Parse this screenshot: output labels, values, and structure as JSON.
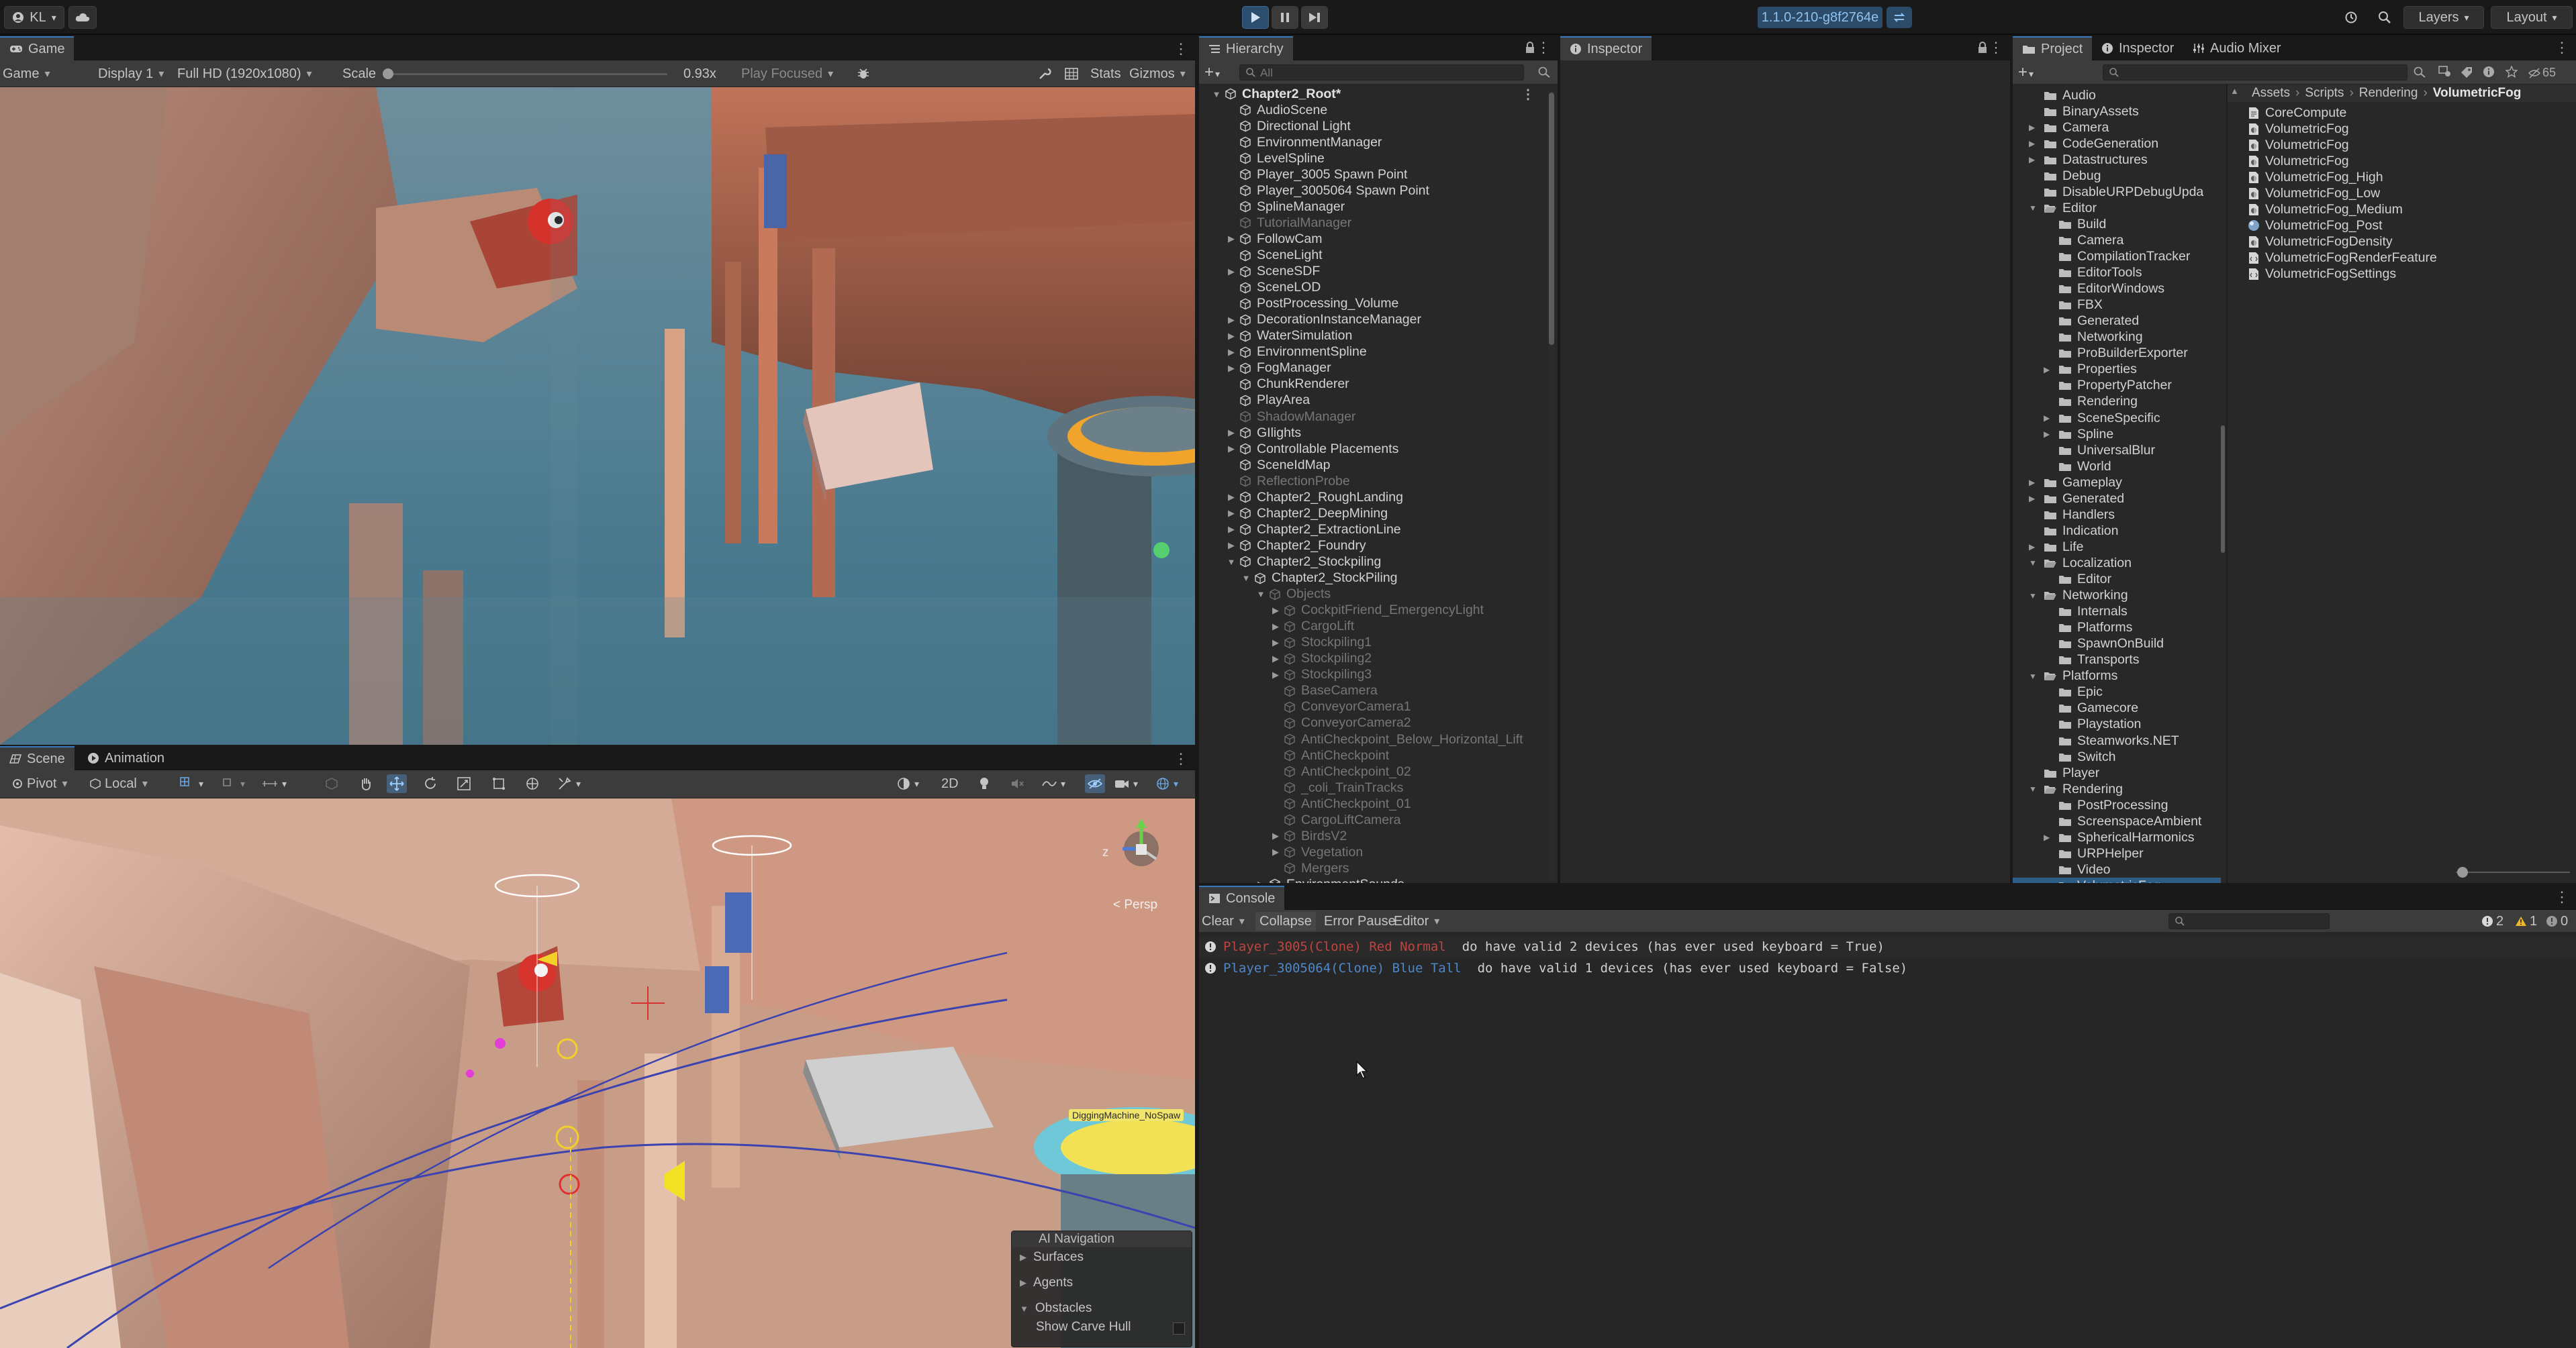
{
  "topbar": {
    "account": "KL",
    "version": "1.1.0-210-g8f2764e",
    "layers": "Layers",
    "layout": "Layout"
  },
  "game": {
    "tab": "Game",
    "mode": "Game",
    "display": "Display 1",
    "resolution": "Full HD (1920x1080)",
    "scale_label": "Scale",
    "scale_value": "0.93x",
    "scale_fraction": 0.0,
    "play_focused": "Play Focused",
    "stats": "Stats",
    "gizmos": "Gizmos"
  },
  "scene": {
    "tab": "Scene",
    "tab2": "Animation",
    "pivot": "Pivot",
    "local": "Local",
    "twod": "2D",
    "persp": "< Persp",
    "axis_z": "z",
    "label_tag": "DiggingMachine_NoSpaw",
    "overlay_title": "AI Navigation",
    "overlay_items": [
      "Surfaces",
      "Agents",
      "Obstacles"
    ],
    "overlay_toggle": "Show Carve Hull"
  },
  "hierarchy": {
    "tab": "Hierarchy",
    "search_placeholder": "All",
    "rows": [
      {
        "label": "Chapter2_Root*",
        "depth": 0,
        "arrow": "open",
        "style": "hdr"
      },
      {
        "label": "AudioScene",
        "depth": 1,
        "arrow": "",
        "style": ""
      },
      {
        "label": "Directional Light",
        "depth": 1,
        "arrow": "",
        "style": ""
      },
      {
        "label": "EnvironmentManager",
        "depth": 1,
        "arrow": "",
        "style": ""
      },
      {
        "label": "LevelSpline",
        "depth": 1,
        "arrow": "",
        "style": ""
      },
      {
        "label": "Player_3005 Spawn Point",
        "depth": 1,
        "arrow": "",
        "style": ""
      },
      {
        "label": "Player_3005064 Spawn Point",
        "depth": 1,
        "arrow": "",
        "style": ""
      },
      {
        "label": "SplineManager",
        "depth": 1,
        "arrow": "",
        "style": ""
      },
      {
        "label": "TutorialManager",
        "depth": 1,
        "arrow": "",
        "style": "dim"
      },
      {
        "label": "FollowCam",
        "depth": 1,
        "arrow": "closed",
        "style": ""
      },
      {
        "label": "SceneLight",
        "depth": 1,
        "arrow": "",
        "style": ""
      },
      {
        "label": "SceneSDF",
        "depth": 1,
        "arrow": "closed",
        "style": ""
      },
      {
        "label": "SceneLOD",
        "depth": 1,
        "arrow": "",
        "style": ""
      },
      {
        "label": "PostProcessing_Volume",
        "depth": 1,
        "arrow": "",
        "style": ""
      },
      {
        "label": "DecorationInstanceManager",
        "depth": 1,
        "arrow": "closed",
        "style": ""
      },
      {
        "label": "WaterSimulation",
        "depth": 1,
        "arrow": "closed",
        "style": ""
      },
      {
        "label": "EnvironmentSpline",
        "depth": 1,
        "arrow": "closed",
        "style": ""
      },
      {
        "label": "FogManager",
        "depth": 1,
        "arrow": "closed",
        "style": ""
      },
      {
        "label": "ChunkRenderer",
        "depth": 1,
        "arrow": "",
        "style": ""
      },
      {
        "label": "PlayArea",
        "depth": 1,
        "arrow": "",
        "style": ""
      },
      {
        "label": "ShadowManager",
        "depth": 1,
        "arrow": "",
        "style": "dim"
      },
      {
        "label": "GIlights",
        "depth": 1,
        "arrow": "closed",
        "style": ""
      },
      {
        "label": "Controllable Placements",
        "depth": 1,
        "arrow": "closed",
        "style": ""
      },
      {
        "label": "SceneIdMap",
        "depth": 1,
        "arrow": "",
        "style": ""
      },
      {
        "label": "ReflectionProbe",
        "depth": 1,
        "arrow": "",
        "style": "dim"
      },
      {
        "label": "Chapter2_RoughLanding",
        "depth": 1,
        "arrow": "closed",
        "style": ""
      },
      {
        "label": "Chapter2_DeepMining",
        "depth": 1,
        "arrow": "closed",
        "style": ""
      },
      {
        "label": "Chapter2_ExtractionLine",
        "depth": 1,
        "arrow": "closed",
        "style": ""
      },
      {
        "label": "Chapter2_Foundry",
        "depth": 1,
        "arrow": "closed",
        "style": ""
      },
      {
        "label": "Chapter2_Stockpiling",
        "depth": 1,
        "arrow": "open",
        "style": ""
      },
      {
        "label": "Chapter2_StockPiling",
        "depth": 2,
        "arrow": "open",
        "style": ""
      },
      {
        "label": "Objects",
        "depth": 3,
        "arrow": "open",
        "style": "dim"
      },
      {
        "label": "CockpitFriend_EmergencyLight",
        "depth": 4,
        "arrow": "closed",
        "style": "dim"
      },
      {
        "label": "CargoLift",
        "depth": 4,
        "arrow": "closed",
        "style": "dim"
      },
      {
        "label": "Stockpiling1",
        "depth": 4,
        "arrow": "closed",
        "style": "dim"
      },
      {
        "label": "Stockpiling2",
        "depth": 4,
        "arrow": "closed",
        "style": "dim"
      },
      {
        "label": "Stockpiling3",
        "depth": 4,
        "arrow": "closed",
        "style": "dim"
      },
      {
        "label": "BaseCamera",
        "depth": 4,
        "arrow": "",
        "style": "dim"
      },
      {
        "label": "ConveyorCamera1",
        "depth": 4,
        "arrow": "",
        "style": "dim"
      },
      {
        "label": "ConveyorCamera2",
        "depth": 4,
        "arrow": "",
        "style": "dim"
      },
      {
        "label": "AntiCheckpoint_Below_Horizontal_Lift",
        "depth": 4,
        "arrow": "",
        "style": "dim"
      },
      {
        "label": "AntiCheckpoint",
        "depth": 4,
        "arrow": "",
        "style": "dim"
      },
      {
        "label": "AntiCheckpoint_02",
        "depth": 4,
        "arrow": "",
        "style": "dim"
      },
      {
        "label": "_coli_TrainTracks",
        "depth": 4,
        "arrow": "",
        "style": "dim"
      },
      {
        "label": "AntiCheckpoint_01",
        "depth": 4,
        "arrow": "",
        "style": "dim"
      },
      {
        "label": "CargoLiftCamera",
        "depth": 4,
        "arrow": "",
        "style": "dim"
      },
      {
        "label": "BirdsV2",
        "depth": 4,
        "arrow": "closed",
        "style": "dim"
      },
      {
        "label": "Vegetation",
        "depth": 4,
        "arrow": "closed",
        "style": "dim"
      },
      {
        "label": "Mergers",
        "depth": 4,
        "arrow": "",
        "style": "dim"
      },
      {
        "label": "EnvironmentSounds",
        "depth": 3,
        "arrow": "closed",
        "style": ""
      }
    ]
  },
  "inspector": {
    "tab": "Inspector"
  },
  "project": {
    "tabs": [
      "Project",
      "Inspector",
      "Audio Mixer"
    ],
    "hidden_count": "65",
    "breadcrumb": [
      "Assets",
      "Scripts",
      "Rendering",
      "VolumetricFog"
    ],
    "tree": [
      {
        "label": "Audio",
        "depth": 0,
        "arrow": ""
      },
      {
        "label": "BinaryAssets",
        "depth": 0,
        "arrow": ""
      },
      {
        "label": "Camera",
        "depth": 0,
        "arrow": "closed"
      },
      {
        "label": "CodeGeneration",
        "depth": 0,
        "arrow": "closed"
      },
      {
        "label": "Datastructures",
        "depth": 0,
        "arrow": "closed"
      },
      {
        "label": "Debug",
        "depth": 0,
        "arrow": ""
      },
      {
        "label": "DisableURPDebugUpda",
        "depth": 0,
        "arrow": ""
      },
      {
        "label": "Editor",
        "depth": 0,
        "arrow": "open"
      },
      {
        "label": "Build",
        "depth": 1,
        "arrow": ""
      },
      {
        "label": "Camera",
        "depth": 1,
        "arrow": ""
      },
      {
        "label": "CompilationTracker",
        "depth": 1,
        "arrow": ""
      },
      {
        "label": "EditorTools",
        "depth": 1,
        "arrow": ""
      },
      {
        "label": "EditorWindows",
        "depth": 1,
        "arrow": ""
      },
      {
        "label": "FBX",
        "depth": 1,
        "arrow": ""
      },
      {
        "label": "Generated",
        "depth": 1,
        "arrow": ""
      },
      {
        "label": "Networking",
        "depth": 1,
        "arrow": ""
      },
      {
        "label": "ProBuilderExporter",
        "depth": 1,
        "arrow": ""
      },
      {
        "label": "Properties",
        "depth": 1,
        "arrow": "closed"
      },
      {
        "label": "PropertyPatcher",
        "depth": 1,
        "arrow": ""
      },
      {
        "label": "Rendering",
        "depth": 1,
        "arrow": ""
      },
      {
        "label": "SceneSpecific",
        "depth": 1,
        "arrow": "closed"
      },
      {
        "label": "Spline",
        "depth": 1,
        "arrow": "closed"
      },
      {
        "label": "UniversalBlur",
        "depth": 1,
        "arrow": ""
      },
      {
        "label": "World",
        "depth": 1,
        "arrow": ""
      },
      {
        "label": "Gameplay",
        "depth": 0,
        "arrow": "closed"
      },
      {
        "label": "Generated",
        "depth": 0,
        "arrow": "closed"
      },
      {
        "label": "Handlers",
        "depth": 0,
        "arrow": ""
      },
      {
        "label": "Indication",
        "depth": 0,
        "arrow": ""
      },
      {
        "label": "Life",
        "depth": 0,
        "arrow": "closed"
      },
      {
        "label": "Localization",
        "depth": 0,
        "arrow": "open"
      },
      {
        "label": "Editor",
        "depth": 1,
        "arrow": ""
      },
      {
        "label": "Networking",
        "depth": 0,
        "arrow": "open"
      },
      {
        "label": "Internals",
        "depth": 1,
        "arrow": ""
      },
      {
        "label": "Platforms",
        "depth": 1,
        "arrow": ""
      },
      {
        "label": "SpawnOnBuild",
        "depth": 1,
        "arrow": ""
      },
      {
        "label": "Transports",
        "depth": 1,
        "arrow": ""
      },
      {
        "label": "Platforms",
        "depth": 0,
        "arrow": "open"
      },
      {
        "label": "Epic",
        "depth": 1,
        "arrow": ""
      },
      {
        "label": "Gamecore",
        "depth": 1,
        "arrow": ""
      },
      {
        "label": "Playstation",
        "depth": 1,
        "arrow": ""
      },
      {
        "label": "Steamworks.NET",
        "depth": 1,
        "arrow": ""
      },
      {
        "label": "Switch",
        "depth": 1,
        "arrow": ""
      },
      {
        "label": "Player",
        "depth": 0,
        "arrow": ""
      },
      {
        "label": "Rendering",
        "depth": 0,
        "arrow": "open"
      },
      {
        "label": "PostProcessing",
        "depth": 1,
        "arrow": ""
      },
      {
        "label": "ScreenspaceAmbient",
        "depth": 1,
        "arrow": ""
      },
      {
        "label": "SphericalHarmonics",
        "depth": 1,
        "arrow": "closed"
      },
      {
        "label": "URPHelper",
        "depth": 1,
        "arrow": ""
      },
      {
        "label": "Video",
        "depth": 1,
        "arrow": ""
      },
      {
        "label": "VolumetricFog",
        "depth": 1,
        "arrow": "",
        "selected": true
      }
    ],
    "files": [
      {
        "label": "CoreCompute",
        "icon": "compute"
      },
      {
        "label": "VolumetricFog",
        "icon": "shader"
      },
      {
        "label": "VolumetricFog",
        "icon": "shader"
      },
      {
        "label": "VolumetricFog",
        "icon": "shader"
      },
      {
        "label": "VolumetricFog_High",
        "icon": "shader"
      },
      {
        "label": "VolumetricFog_Low",
        "icon": "shader"
      },
      {
        "label": "VolumetricFog_Medium",
        "icon": "shader"
      },
      {
        "label": "VolumetricFog_Post",
        "icon": "material"
      },
      {
        "label": "VolumetricFogDensity",
        "icon": "shader"
      },
      {
        "label": "VolumetricFogRenderFeature",
        "icon": "script"
      },
      {
        "label": "VolumetricFogSettings",
        "icon": "script"
      }
    ]
  },
  "console": {
    "tab": "Console",
    "clear": "Clear",
    "collapse": "Collapse",
    "error_pause": "Error Pause",
    "editor": "Editor",
    "count_log": "2",
    "count_warn": "1",
    "count_err": "0",
    "entries": [
      {
        "name": "Player_3005(Clone) Red Normal",
        "name_color": "#c0453f",
        "message": "do have valid 2 devices (has ever used keyboard = True)"
      },
      {
        "name": "Player_3005064(Clone) Blue Tall",
        "name_color": "#4f87c7",
        "message": "do have valid 1 devices (has ever used keyboard = False)"
      }
    ]
  },
  "colors": {
    "accent": "#3a79bb",
    "play_active": "#2b4d6e",
    "selection": "#2c5d87",
    "warning": "#f1b72a"
  }
}
